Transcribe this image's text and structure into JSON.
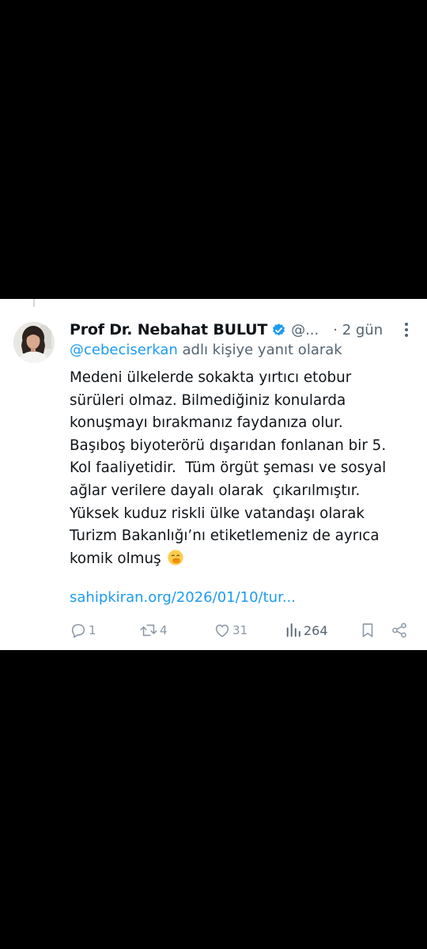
{
  "tweet": {
    "author_name": "Prof Dr. Nebahat BULUT",
    "handle": "@...",
    "time_label": "· 2 gün",
    "reply_to": {
      "mention": "@cebeciserkan",
      "suffix": " adlı kişiye yanıt olarak"
    },
    "text_lines": [
      "Medeni ülkelerde sokakta yırtıcı etobur",
      "sürüleri olmaz. Bilmediğiniz konularda",
      "konuşmayı bırakmanız faydanıza olur.",
      "Başıboş biyoterörü dışarıdan fonlanan bir 5.",
      "Kol faaliyetidir.  Tüm örgüt şeması ve sosyal",
      "ağlar verilere dayalı olarak  çıkarılmıştır.",
      "Yüksek kuduz riskli ülke vatandaşı olarak",
      "Turizm Bakanlığı’nı etiketlemeniz de ayrıca",
      "komik olmuş"
    ],
    "emoji": "face-with-hand-over-mouth",
    "link": "sahipkiran.org/2026/01/10/tur...",
    "actions": {
      "reply_count": "1",
      "retweet_count": "4",
      "like_count": "31",
      "view_count": "264"
    }
  },
  "colors": {
    "background": "#000000",
    "card": "#ffffff",
    "text": "#0f1419",
    "secondary": "#536471",
    "accent": "#1d9bf0",
    "icon": "#8b98a5"
  },
  "icons": [
    "verified-badge-icon",
    "more-icon",
    "reply-icon",
    "retweet-icon",
    "like-icon",
    "views-icon",
    "bookmark-icon",
    "share-icon"
  ]
}
